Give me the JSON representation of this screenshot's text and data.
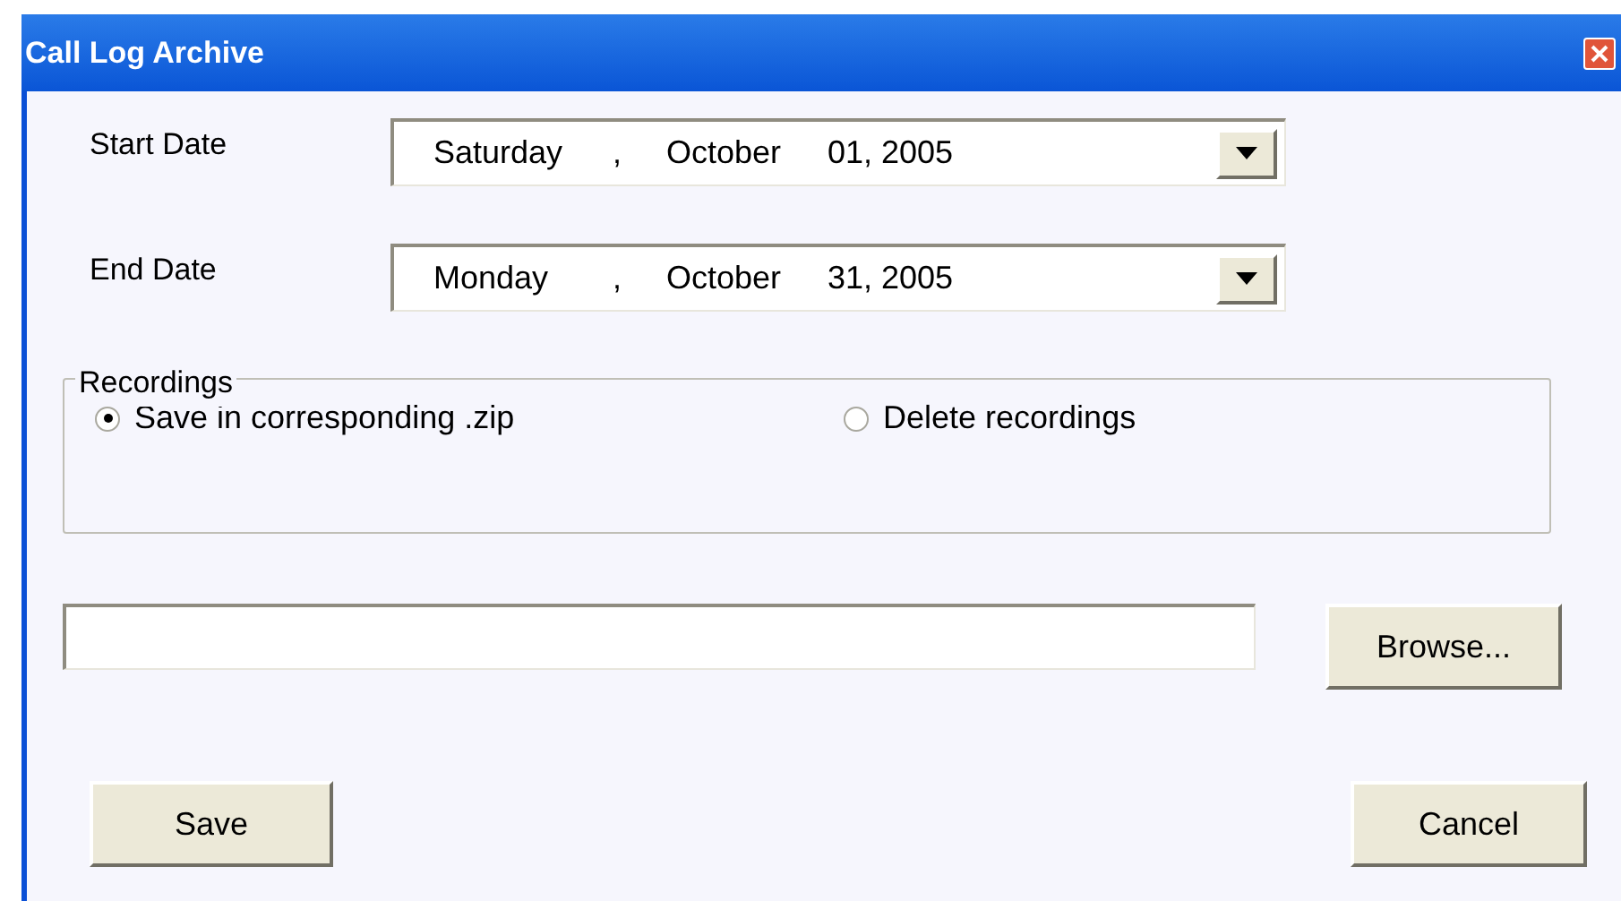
{
  "window": {
    "title": "Call Log Archive"
  },
  "dates": [
    {
      "label": "Start Date",
      "parts": [
        "Saturday",
        ",",
        "October",
        "01, 2005"
      ]
    },
    {
      "label": "End Date",
      "parts": [
        "Monday",
        ",",
        "October",
        "31, 2005"
      ]
    }
  ],
  "recordings": {
    "legend": "Recordings",
    "options": [
      {
        "label": "Save in corresponding .zip",
        "selected": true
      },
      {
        "label": "Delete recordings",
        "selected": false
      }
    ]
  },
  "buttons": {
    "browse": "Browse...",
    "save": "Save",
    "cancel": "Cancel"
  }
}
